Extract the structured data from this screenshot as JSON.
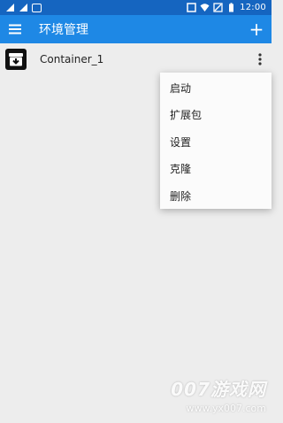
{
  "status_bar": {
    "time": "12:00",
    "icons": [
      "notification-icon",
      "notification-icon",
      "gallery-icon",
      "signal-icon",
      "wifi-icon",
      "no-sim-icon",
      "battery-icon"
    ]
  },
  "app_bar": {
    "title": "环境管理",
    "add_label": "+"
  },
  "containers": [
    {
      "name": "Container_1"
    }
  ],
  "menu": {
    "items": [
      "启动",
      "扩展包",
      "设置",
      "克隆",
      "删除"
    ]
  },
  "watermark": {
    "main": "007游戏网",
    "url": "www.yx007.com"
  },
  "colors": {
    "status_bar": "#1565c0",
    "app_bar": "#1e88e5",
    "background": "#ededed"
  }
}
